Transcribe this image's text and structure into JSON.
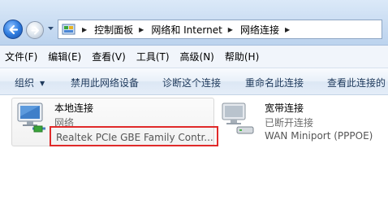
{
  "address": {
    "breadcrumbs": [
      "控制面板",
      "网络和 Internet",
      "网络连接"
    ]
  },
  "menu": [
    "文件(F)",
    "编辑(E)",
    "查看(V)",
    "工具(T)",
    "高级(N)",
    "帮助(H)"
  ],
  "toolbar": {
    "organize": "组织",
    "disable": "禁用此网络设备",
    "diagnose": "诊断这个连接",
    "rename": "重命名此连接",
    "view_status": "查看此连接的"
  },
  "connections": [
    {
      "name": "本地连接",
      "status": "网络",
      "device": "Realtek PCIe GBE Family Contr..."
    },
    {
      "name": "宽带连接",
      "status": "已断开连接",
      "device": "WAN Miniport (PPPOE)"
    }
  ],
  "colors": {
    "highlight": "#e02a2a",
    "command_text": "#1e395b"
  }
}
